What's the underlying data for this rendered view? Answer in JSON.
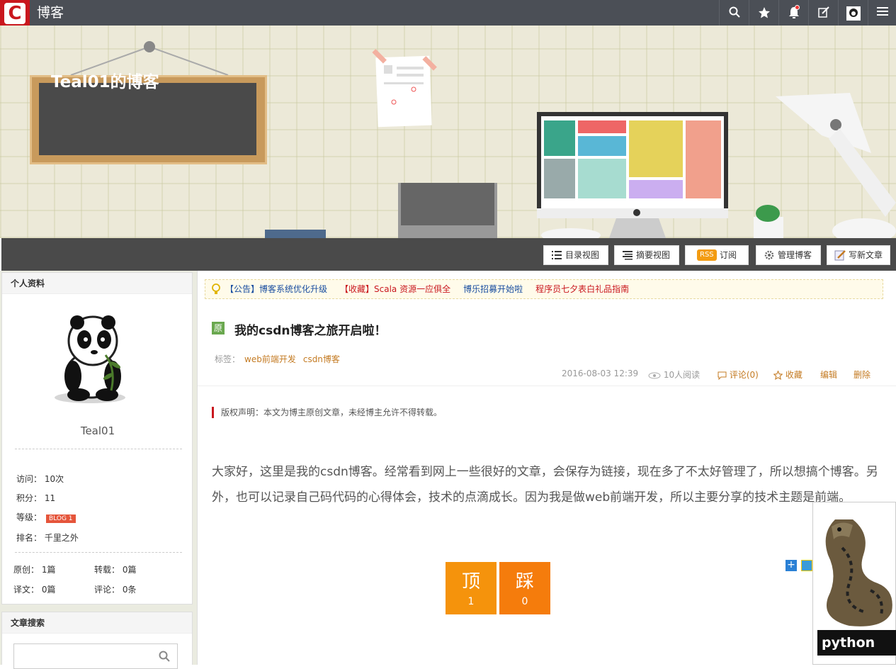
{
  "topbar": {
    "logo": "C",
    "site_name": "博客",
    "icons": [
      "search-icon",
      "star-icon",
      "bell-icon",
      "edit-icon",
      "avatar-icon",
      "menu-icon"
    ]
  },
  "banner": {
    "blog_title": "Teal01的博客"
  },
  "toolbar": {
    "catalog_view": "目录视图",
    "summary_view": "摘要视图",
    "rss_badge": "RSS",
    "subscribe": "订阅",
    "manage": "管理博客",
    "write": "写新文章"
  },
  "profile": {
    "title": "个人资料",
    "username": "Teal01",
    "visits_label": "访问：",
    "visits": "10次",
    "points_label": "积分：",
    "points": "11",
    "level_label": "等级：",
    "level_badge": "BLOG 1",
    "rank_label": "排名：",
    "rank": "千里之外",
    "original_label": "原创：",
    "original": "1篇",
    "repost_label": "转载：",
    "repost": "0篇",
    "translate_label": "译文：",
    "translate": "0篇",
    "comments_label": "评论：",
    "comments": "0条"
  },
  "search_panel": {
    "title": "文章搜索"
  },
  "notice": {
    "items": [
      {
        "text": "【公告】博客系统优化升级",
        "color": "#1a4ea0"
      },
      {
        "text": "【收藏】Scala 资源一应俱全",
        "color": "#c9171e"
      },
      {
        "text": "博乐招募开始啦",
        "color": "#1a4ea0"
      },
      {
        "text": "程序员七夕表白礼品指南",
        "color": "#c9171e"
      }
    ]
  },
  "article": {
    "badge": "原",
    "title": "我的csdn博客之旅开启啦！",
    "tags_label": "标签：",
    "tags": [
      "web前端开发",
      "csdn博客"
    ],
    "date": "2016-08-03 12:39",
    "reads": "10人阅读",
    "comments": "评论(0)",
    "favorite": "收藏",
    "edit": "编辑",
    "delete": "删除",
    "copyright": "版权声明：本文为博主原创文章，未经博主允许不得转载。",
    "body": "大家好，这里是我的csdn博客。经常看到网上一些很好的文章，会保存为链接，现在多了不太好管理了，所以想搞个博客。另外，也可以记录自己码代码的心得体会，技术的点滴成长。因为我是做web前端开发，所以主要分享的技术主题是前端。",
    "up_label": "顶",
    "up_count": "1",
    "down_label": "踩",
    "down_count": "0"
  },
  "ad": {
    "label": "python"
  },
  "colors": {
    "topbar": "#4b4f56",
    "brand": "#c9171e",
    "vote_up": "#f5930c",
    "vote_down": "#f57c0c",
    "link": "#c47b23"
  }
}
